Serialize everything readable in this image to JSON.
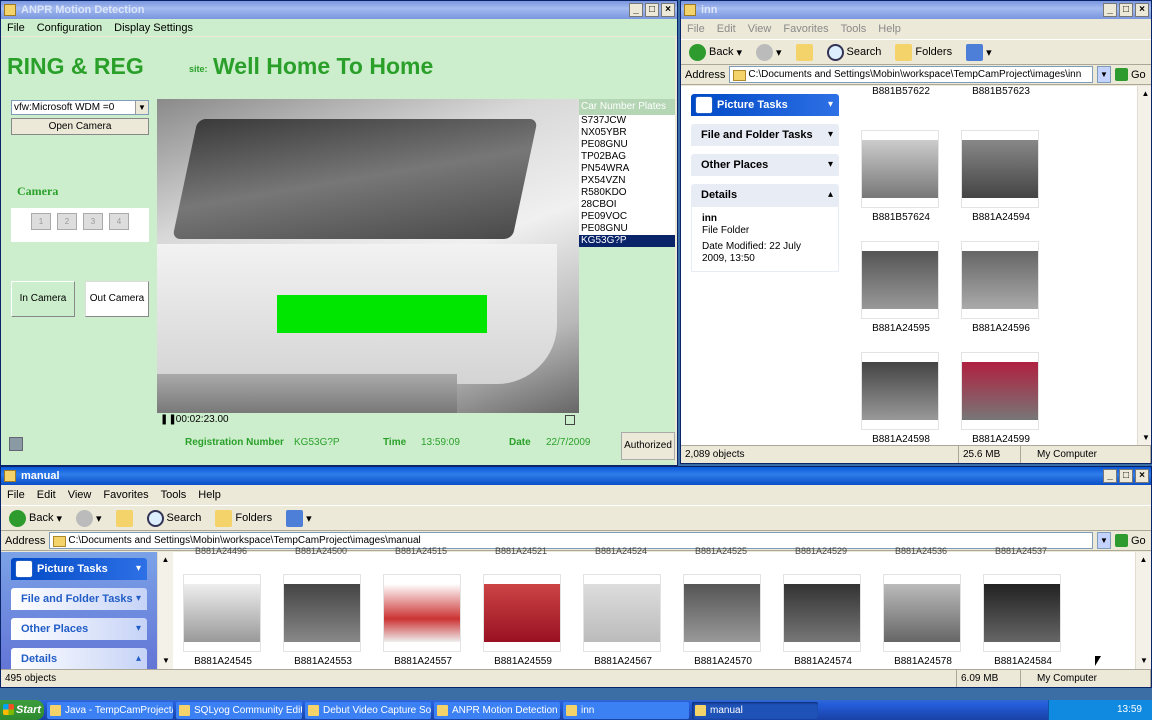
{
  "anpr": {
    "title": "ANPR Motion Detection",
    "menu": [
      "File",
      "Configuration",
      "Display Settings"
    ],
    "app_name": "RING & REG",
    "site_label": "site:",
    "site_name": "Well Home To Home",
    "camera_select": "vfw:Microsoft WDM =0",
    "open_camera": "Open Camera",
    "camera_heading": "Camera",
    "camera_buttons": [
      "1",
      "2",
      "3",
      "4"
    ],
    "in_camera": "In Camera",
    "out_camera": "Out Camera",
    "plates_header": "Car Number Plates",
    "plates": [
      "S737JCW",
      "NX05YBR",
      "PE08GNU",
      "TP02BAG",
      "PN54WRA",
      "PX54VZN",
      "R580KDO",
      "28CBOI",
      "PE09VOC",
      "PE08GNU",
      "KG53G?P"
    ],
    "selected_plate_index": 10,
    "video_time": "00:02:23.00",
    "reg_label": "Registration Number",
    "reg_value": "KG53G?P",
    "time_label": "Time",
    "time_value": "13:59:09",
    "date_label": "Date",
    "date_value": "22/7/2009",
    "authorized": "Authorized"
  },
  "inn": {
    "title": "inn",
    "menu": [
      "File",
      "Edit",
      "View",
      "Favorites",
      "Tools",
      "Help"
    ],
    "back": "Back",
    "search": "Search",
    "folders": "Folders",
    "address_label": "Address",
    "address": "C:\\Documents and Settings\\Mobin\\workspace\\TempCamProject\\images\\inn",
    "go": "Go",
    "picture_tasks": "Picture Tasks",
    "file_folder_tasks": "File and Folder Tasks",
    "other_places": "Other Places",
    "details": "Details",
    "details_name": "inn",
    "details_type": "File Folder",
    "details_modified": "Date Modified: 22 July 2009, 13:50",
    "files": [
      "B881B57622",
      "B881B57623",
      "B881B57624",
      "B881A24594",
      "B881A24595",
      "B881A24596",
      "B881A24598",
      "B881A24599"
    ],
    "status_objects": "2,089 objects",
    "status_size": "25.6 MB",
    "status_zone": "My Computer"
  },
  "manual": {
    "title": "manual",
    "menu": [
      "File",
      "Edit",
      "View",
      "Favorites",
      "Tools",
      "Help"
    ],
    "back": "Back",
    "search": "Search",
    "folders": "Folders",
    "address_label": "Address",
    "address": "C:\\Documents and Settings\\Mobin\\workspace\\TempCamProject\\images\\manual",
    "go": "Go",
    "picture_tasks": "Picture Tasks",
    "file_folder_tasks": "File and Folder Tasks",
    "other_places": "Other Places",
    "details": "Details",
    "top_row": [
      "B881A24496",
      "B881A24500",
      "B881A24515",
      "B881A24521",
      "B881A24524",
      "B881A24525",
      "B881A24529",
      "B881A24536",
      "B881A24537"
    ],
    "files": [
      "B881A24545",
      "B881A24553",
      "B881A24557",
      "B881A24559",
      "B881A24567",
      "B881A24570",
      "B881A24574",
      "B881A24578",
      "B881A24584"
    ],
    "status_objects": "495 objects",
    "status_size": "6.09 MB",
    "status_zone": "My Computer"
  },
  "taskbar": {
    "start": "Start",
    "tasks": [
      "Java - TempCamProject/...",
      "SQLyog Community Editi...",
      "Debut Video Capture Sof...",
      "ANPR Motion Detection",
      "inn",
      "manual"
    ],
    "clock": "13:59"
  },
  "colors": {
    "anpr_bg": "#cceecc",
    "site_green": "#2aa02a",
    "highlight_green": "#00e600",
    "selection": "#0a246a"
  }
}
